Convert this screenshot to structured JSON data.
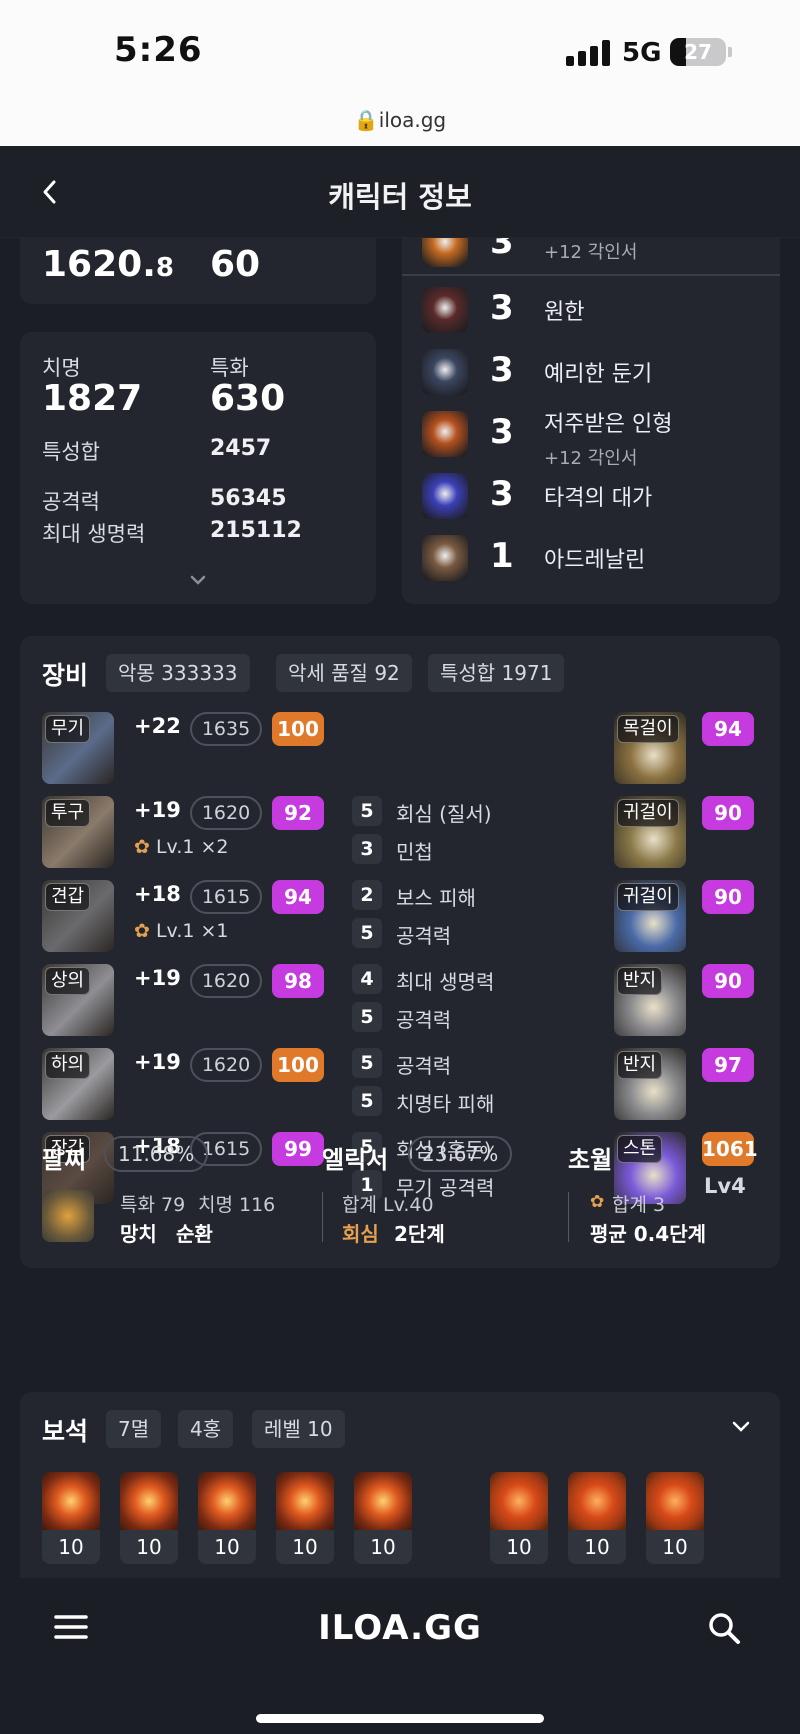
{
  "status_bar": {
    "time": "5:26",
    "network": "5G",
    "battery": "27",
    "url": "iloa.gg"
  },
  "header": {
    "title": "캐릭터 정보"
  },
  "stats": {
    "item_level_value": "1620.",
    "item_level_decimal": "8",
    "level_value": "60",
    "crit_label": "치명",
    "crit_value": "1827",
    "spec_label": "특화",
    "spec_value": "630",
    "stat_sum_label": "특성합",
    "stat_sum_value": "2457",
    "attack_label": "공격력",
    "attack_value": "56345",
    "hp_label": "최대 생명력",
    "hp_value": "215112"
  },
  "engravings": [
    {
      "level": "3",
      "name": "",
      "sub": "+12 각인서",
      "color": "#c46a20"
    },
    {
      "level": "3",
      "name": "원한",
      "sub": "",
      "color": "#5a2a2a"
    },
    {
      "level": "3",
      "name": "예리한 둔기",
      "sub": "",
      "color": "#3a4660"
    },
    {
      "level": "3",
      "name": "저주받은 인형",
      "sub": "+12 각인서",
      "color": "#b4501e"
    },
    {
      "level": "3",
      "name": "타격의 대가",
      "sub": "",
      "color": "#3b40b8"
    },
    {
      "level": "1",
      "name": "아드레날린",
      "sub": "",
      "color": "#7a5a40"
    }
  ],
  "equipment": {
    "title": "장비",
    "chips": [
      "악몽 333333",
      "악세 품질 92",
      "특성합 1971"
    ],
    "armor": [
      {
        "slot": "무기",
        "upgrade": "+22",
        "item_level": "1635",
        "quality": "100",
        "quality_color": "orange",
        "extra": "",
        "color": "#5a6b8a"
      },
      {
        "slot": "투구",
        "upgrade": "+19",
        "item_level": "1620",
        "quality": "92",
        "quality_color": "purple",
        "extra": "Lv.1 ×2",
        "color": "#8a7a6a"
      },
      {
        "slot": "견갑",
        "upgrade": "+18",
        "item_level": "1615",
        "quality": "94",
        "quality_color": "purple",
        "extra": "Lv.1 ×1",
        "color": "#6a6a6e"
      },
      {
        "slot": "상의",
        "upgrade": "+19",
        "item_level": "1620",
        "quality": "98",
        "quality_color": "purple",
        "extra": "",
        "color": "#8e8e94"
      },
      {
        "slot": "하의",
        "upgrade": "+19",
        "item_level": "1620",
        "quality": "100",
        "quality_color": "orange",
        "extra": "",
        "color": "#9a9aa0"
      },
      {
        "slot": "장갑",
        "upgrade": "+18",
        "item_level": "1615",
        "quality": "99",
        "quality_color": "purple",
        "extra": "",
        "color": "#5a4a42"
      }
    ],
    "options": [
      {
        "n": "5",
        "t": "회심 (질서)"
      },
      {
        "n": "3",
        "t": "민첩"
      },
      {
        "n": "2",
        "t": "보스 피해"
      },
      {
        "n": "5",
        "t": "공격력"
      },
      {
        "n": "4",
        "t": "최대 생명력"
      },
      {
        "n": "5",
        "t": "공격력"
      },
      {
        "n": "5",
        "t": "공격력"
      },
      {
        "n": "5",
        "t": "치명타 피해"
      },
      {
        "n": "5",
        "t": "회심 (혼돈)"
      },
      {
        "n": "1",
        "t": "무기 공격력"
      }
    ],
    "accessories": [
      {
        "slot": "목걸이",
        "quality": "94",
        "quality_color": "purple",
        "color": "#8a7040"
      },
      {
        "slot": "귀걸이",
        "quality": "90",
        "quality_color": "purple",
        "color": "#8a7848"
      },
      {
        "slot": "귀걸이",
        "quality": "90",
        "quality_color": "purple",
        "color": "#4a6aa8"
      },
      {
        "slot": "반지",
        "quality": "90",
        "quality_color": "purple",
        "color": "#8a8a8e"
      },
      {
        "slot": "반지",
        "quality": "97",
        "quality_color": "purple",
        "color": "#8a8a8e"
      },
      {
        "slot": "스톤",
        "quality": "1061",
        "quality_color": "orange",
        "color": "#7a5ad8",
        "extra": "Lv4"
      }
    ],
    "bracelet": {
      "label": "팔찌",
      "percent": "11.68%",
      "line1a": "특화 79",
      "line1b": "치명 116",
      "line2a": "망치",
      "line2b": "순환"
    },
    "elixir": {
      "label": "엘릭서",
      "percent": "23.67%",
      "line1": "합계 Lv.40",
      "line2a": "회심",
      "line2b": "2단계"
    },
    "transcend": {
      "label": "초월",
      "line1": "합계 3",
      "line2": "평균 0.4단계"
    }
  },
  "gems": {
    "title": "보석",
    "chips": [
      "7멸",
      "4홍",
      "레벨 10"
    ],
    "items": [
      {
        "level": "10",
        "kind": "doom"
      },
      {
        "level": "10",
        "kind": "doom"
      },
      {
        "level": "10",
        "kind": "doom"
      },
      {
        "level": "10",
        "kind": "doom"
      },
      {
        "level": "10",
        "kind": "doom"
      },
      {
        "level": "10",
        "kind": "bloom"
      },
      {
        "level": "10",
        "kind": "bloom"
      },
      {
        "level": "10",
        "kind": "bloom"
      }
    ]
  },
  "bottom_bar": {
    "logo": "ILOA.GG"
  }
}
